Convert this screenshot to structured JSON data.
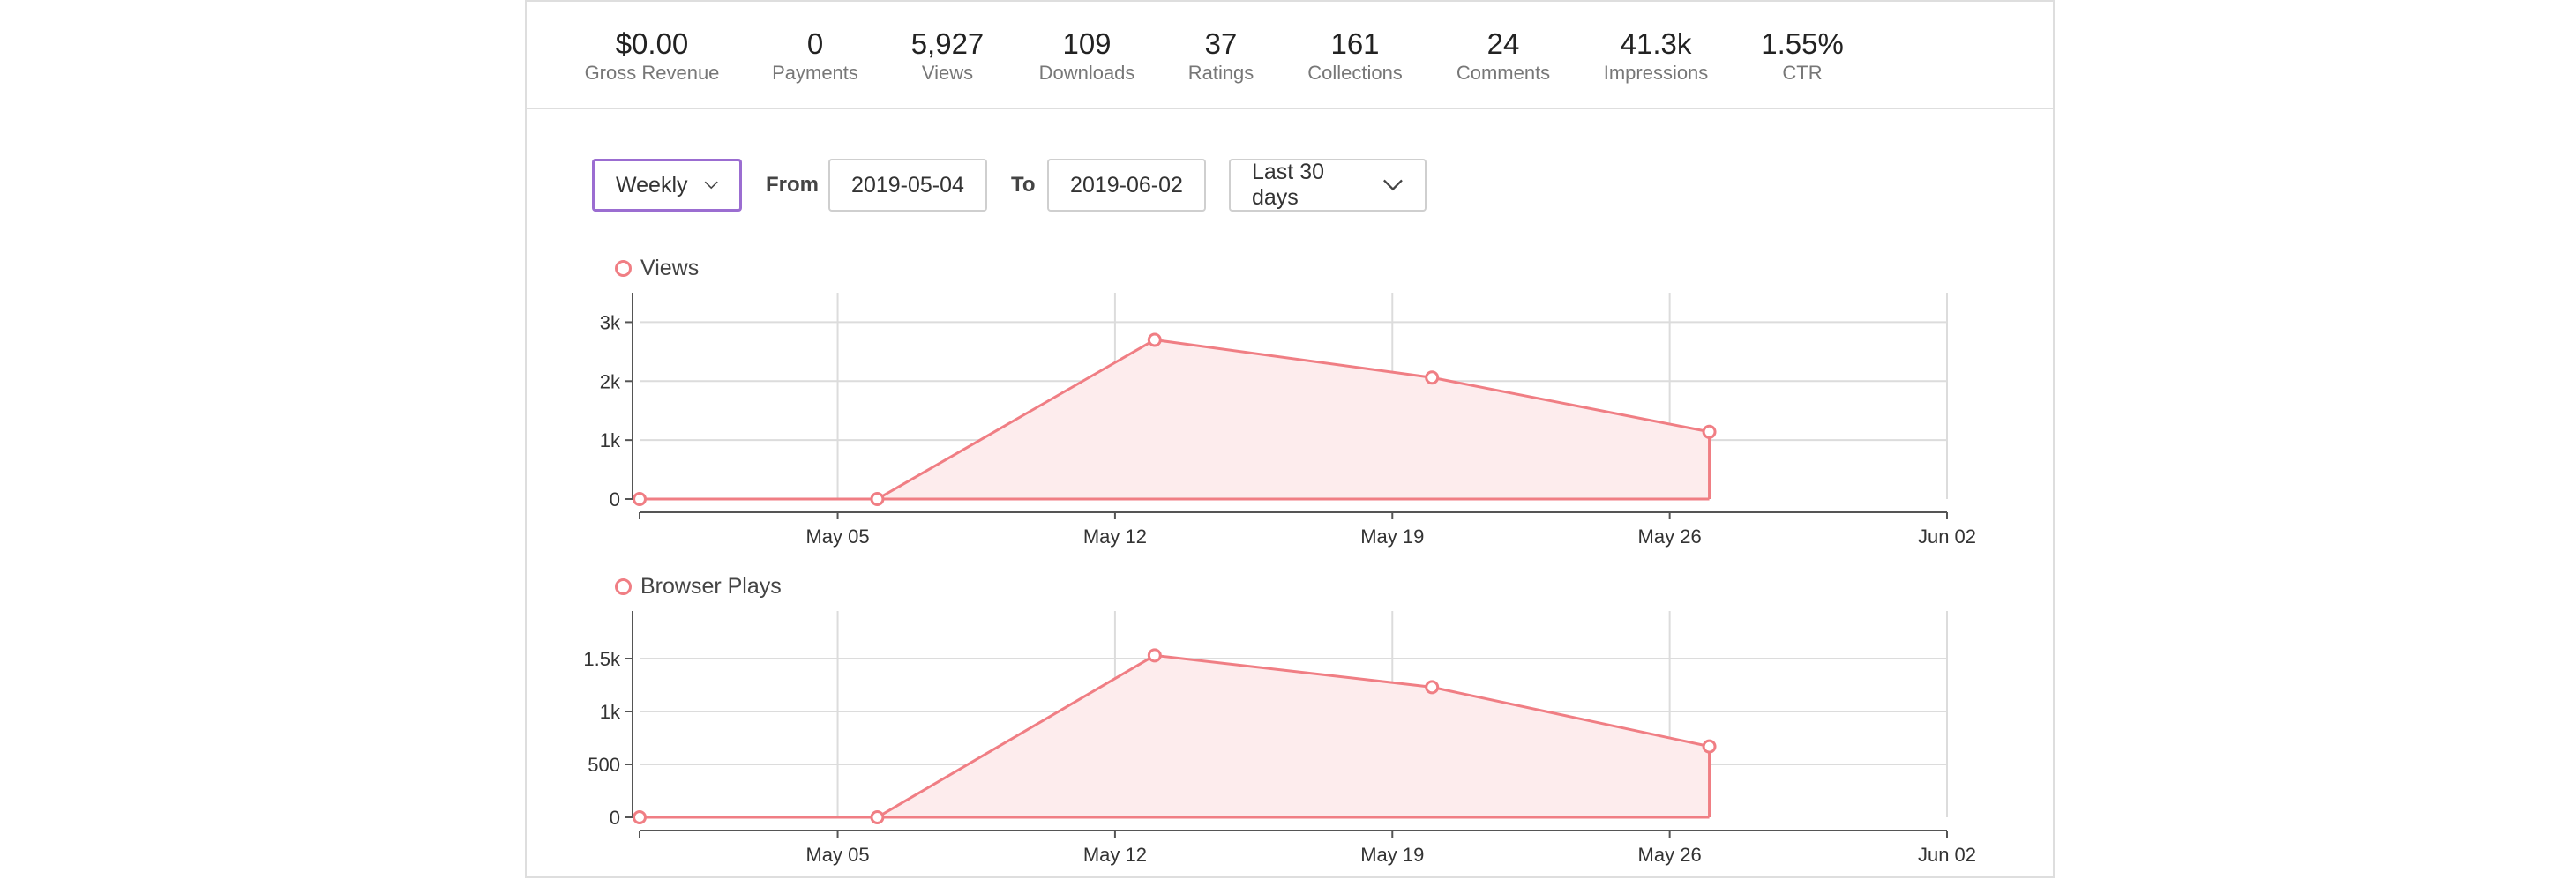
{
  "stats": [
    {
      "value": "$0.00",
      "label": "Gross Revenue"
    },
    {
      "value": "0",
      "label": "Payments"
    },
    {
      "value": "5,927",
      "label": "Views"
    },
    {
      "value": "109",
      "label": "Downloads"
    },
    {
      "value": "37",
      "label": "Ratings"
    },
    {
      "value": "161",
      "label": "Collections"
    },
    {
      "value": "24",
      "label": "Comments"
    },
    {
      "value": "41.3k",
      "label": "Impressions"
    },
    {
      "value": "1.55%",
      "label": "CTR"
    }
  ],
  "filters": {
    "interval": "Weekly",
    "from_label": "From",
    "from_value": "2019-05-04",
    "to_label": "To",
    "to_value": "2019-06-02",
    "range": "Last 30 days"
  },
  "colors": {
    "series": "#f07e84",
    "fill": "#fdeced",
    "accent": "#9b6dd1"
  },
  "chart_data": [
    {
      "type": "area",
      "legend": "Views",
      "x": [
        "2019-04-30",
        "2019-05-06",
        "2019-05-13",
        "2019-05-20",
        "2019-05-27"
      ],
      "y": [
        0,
        0,
        2700,
        2060,
        1140
      ],
      "ylim": [
        0,
        3500
      ],
      "yticks": [
        0,
        1000,
        2000,
        3000
      ],
      "ytick_labels": [
        "0",
        "1k",
        "2k",
        "3k"
      ],
      "xticks": [
        "2019-05-05",
        "2019-05-12",
        "2019-05-19",
        "2019-05-26",
        "2019-06-02"
      ],
      "xtick_labels": [
        "May 05",
        "May 12",
        "May 19",
        "May 26",
        "Jun 02"
      ],
      "xlim": [
        "2019-04-30",
        "2019-06-02"
      ]
    },
    {
      "type": "area",
      "legend": "Browser Plays",
      "x": [
        "2019-04-30",
        "2019-05-06",
        "2019-05-13",
        "2019-05-20",
        "2019-05-27"
      ],
      "y": [
        0,
        0,
        1530,
        1230,
        670
      ],
      "ylim": [
        0,
        1950
      ],
      "yticks": [
        0,
        500,
        1000,
        1500
      ],
      "ytick_labels": [
        "0",
        "500",
        "1k",
        "1.5k"
      ],
      "xticks": [
        "2019-05-05",
        "2019-05-12",
        "2019-05-19",
        "2019-05-26",
        "2019-06-02"
      ],
      "xtick_labels": [
        "May 05",
        "May 12",
        "May 19",
        "May 26",
        "Jun 02"
      ],
      "xlim": [
        "2019-04-30",
        "2019-06-02"
      ]
    }
  ]
}
